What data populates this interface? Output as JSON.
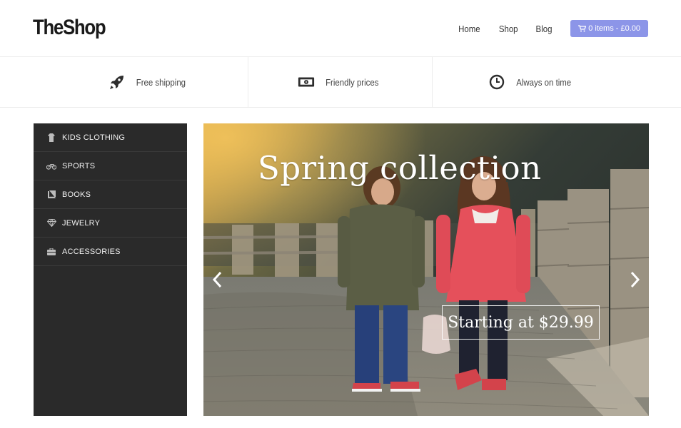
{
  "header": {
    "logo": "TheShop",
    "nav": [
      "Home",
      "Shop",
      "Blog"
    ],
    "cart_label": "0 items - £0.00",
    "cart_color": "#8c95e8"
  },
  "features": [
    {
      "icon": "rocket-icon",
      "label": "Free shipping"
    },
    {
      "icon": "money-icon",
      "label": "Friendly prices"
    },
    {
      "icon": "clock-icon",
      "label": "Always on time"
    }
  ],
  "sidebar": {
    "items": [
      {
        "icon": "shirt-icon",
        "label": "KIDS CLOTHING"
      },
      {
        "icon": "bicycle-icon",
        "label": "SPORTS"
      },
      {
        "icon": "book-icon",
        "label": "BOOKS"
      },
      {
        "icon": "diamond-icon",
        "label": "JEWELRY"
      },
      {
        "icon": "briefcase-icon",
        "label": "ACCESSORIES"
      }
    ],
    "background": "#2a2a2a"
  },
  "slider": {
    "title": "Spring collection",
    "caption": "Starting at $29.99"
  }
}
